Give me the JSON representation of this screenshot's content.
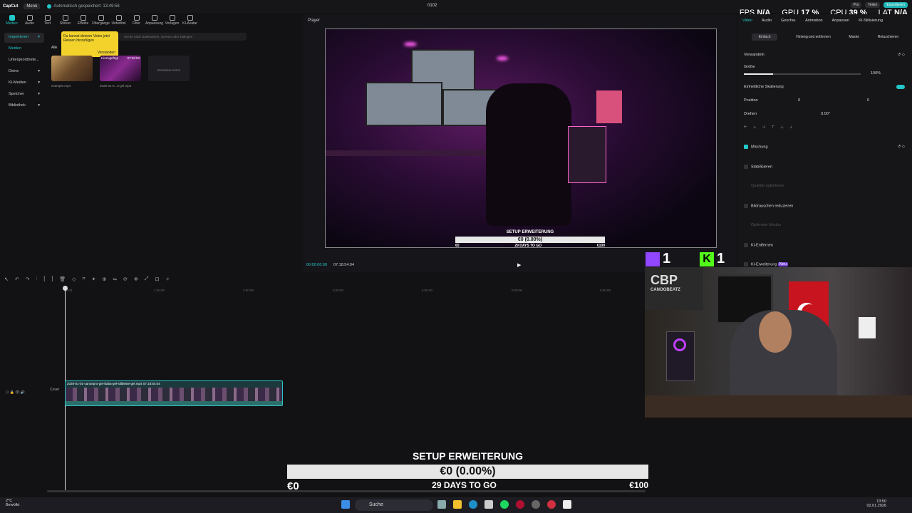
{
  "titlebar": {
    "app": "CapCut",
    "menu": "Menü",
    "saved": "Automatisch gespeichert: 13:49:58",
    "project": "0102",
    "pro": "Pro",
    "share": "Teilen",
    "export": "Exportieren"
  },
  "stats": {
    "fps_label": "FPS",
    "fps_value": "N/A",
    "gpu_label": "GPU",
    "gpu_value": "17 %",
    "cpu_label": "CPU",
    "cpu_value": "39 %",
    "lat_label": "LAT",
    "lat_value": "N/A"
  },
  "toolbar": [
    "Medien",
    "Audio",
    "Text",
    "Sticker",
    "Effekte",
    "Übergänge",
    "Untertitel",
    "Filter",
    "Anpassung",
    "Vorlagen",
    "KI-Avatar"
  ],
  "leftnav": [
    "Importieren",
    "Medien",
    "Untergeordnete...",
    "Deine",
    "KI-Medien",
    "Speicher",
    "Bibliothek"
  ],
  "media": {
    "all": "Alle",
    "search_placeholder": "Suche nach Dateinamen, Szenen oder Dialogen",
    "tip_text": "Du kannst deinem Video jetzt Ressen hinzufügen",
    "tip_button": "Verstanden",
    "thumb_badge": "Hinzugefügt",
    "thumb_duration": "07:18:53",
    "clip1": "example.mp4",
    "clip2": "2026-01-0...a-gel.mp4",
    "generate": "Generiere mit KI"
  },
  "player": {
    "header": "Player",
    "time_current": "00:00:00:00",
    "time_total": "07:18:54:04"
  },
  "overlay": {
    "title": "SETUP ERWEITERUNG",
    "amount": "€0 (0.00%)",
    "days": "29 DAYS TO GO",
    "start": "€0",
    "goal": "€100"
  },
  "rpanel": {
    "tabs": [
      "Video",
      "Audio",
      "Geschw.",
      "Animation",
      "Anpassen",
      "KI-Stilisierung"
    ],
    "subtabs": [
      "Einfach",
      "Hintergrund entfernen",
      "Maske",
      "Retuschieren"
    ],
    "transform": "Verwandeln",
    "size": "Größe",
    "size_value": "100%",
    "uniform": "Einheitliche Skalierung",
    "position": "Position",
    "pos_x": "0",
    "pos_y": "0",
    "rotate": "Drehen",
    "rotate_value": "0.00°",
    "blend": "Mischung",
    "stabilize": "Stabilisieren",
    "quality": "Qualität optimieren",
    "denoise": "Bildrauschen reduzieren",
    "optimal": "Optimaler Modus",
    "ai_remove": "KI-Entfernen",
    "ai_extend": "KI-Erweiterung",
    "new_badge": "Neu"
  },
  "timeline": {
    "ruler": [
      "00:00",
      "1:00:00",
      "2:00:00",
      "3:00:00",
      "4:00:00",
      "5:00:00",
      "6:00:00"
    ],
    "clip_name": "2026-01-01-canoepro-get-baba-gel-stilbeste-gel.mp4",
    "clip_duration": "07:18:54:04",
    "cover": "Cover"
  },
  "social": {
    "twitch": "1",
    "kick": "1"
  },
  "webcam": {
    "brand": "CBP",
    "brand_sub": "CANOOBEATZ"
  },
  "taskbar": {
    "temp": "2°C",
    "weather": "Bewölkt",
    "search": "Suche",
    "time": "13:50",
    "date": "02.01.2026"
  },
  "colors": {
    "accent": "#23c7c7",
    "twitch": "#9146ff",
    "kick": "#53fc18",
    "flag": "#c8141e"
  }
}
